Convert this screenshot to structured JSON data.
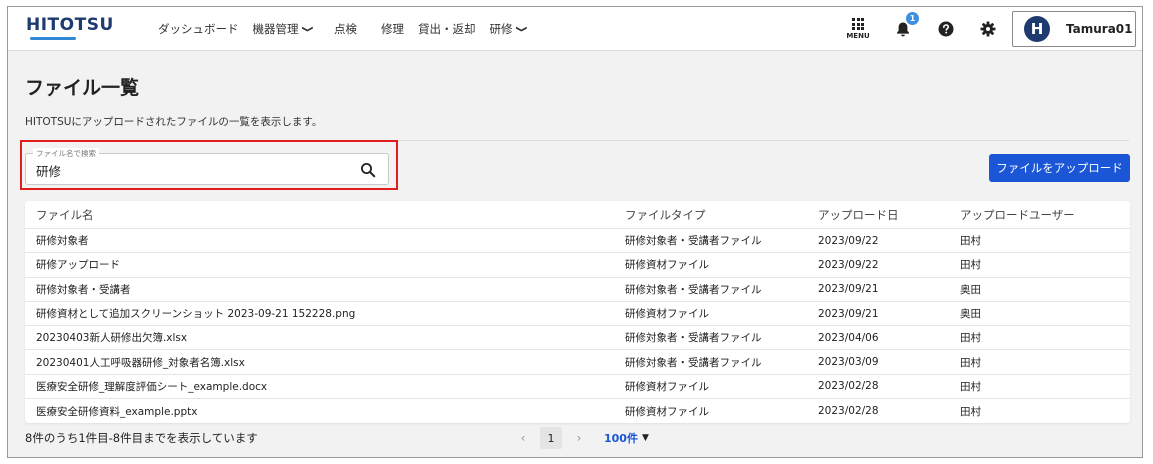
{
  "header": {
    "logo": "HITOTSU",
    "nav": [
      {
        "label": "ダッシュボード",
        "has_dropdown": false
      },
      {
        "label": "機器管理",
        "has_dropdown": true
      },
      {
        "label": "点検",
        "has_dropdown": false
      },
      {
        "label": "修理",
        "has_dropdown": false
      },
      {
        "label": "貸出・返却",
        "has_dropdown": false
      },
      {
        "label": "研修",
        "has_dropdown": true
      }
    ],
    "menu_label": "MENU",
    "notification_count": "1",
    "user": {
      "initial": "H",
      "name": "Tamura01"
    }
  },
  "page": {
    "title": "ファイル一覧",
    "description": "HITOTSUにアップロードされたファイルの一覧を表示します。"
  },
  "search": {
    "legend": "ファイル名で検索",
    "value": "研修"
  },
  "upload_button": "ファイルをアップロード",
  "table": {
    "columns": [
      "ファイル名",
      "ファイルタイプ",
      "アップロード日",
      "アップロードユーザー"
    ],
    "rows": [
      [
        "研修対象者",
        "研修対象者・受講者ファイル",
        "2023/09/22",
        "田村"
      ],
      [
        "研修アップロード",
        "研修資材ファイル",
        "2023/09/22",
        "田村"
      ],
      [
        "研修対象者・受講者",
        "研修対象者・受講者ファイル",
        "2023/09/21",
        "奥田"
      ],
      [
        "研修資材として追加スクリーンショット 2023-09-21 152228.png",
        "研修資材ファイル",
        "2023/09/21",
        "奥田"
      ],
      [
        "20230403新人研修出欠簿.xlsx",
        "研修対象者・受講者ファイル",
        "2023/04/06",
        "田村"
      ],
      [
        "20230401人工呼吸器研修_対象者名簿.xlsx",
        "研修対象者・受講者ファイル",
        "2023/03/09",
        "田村"
      ],
      [
        "医療安全研修_理解度評価シート_example.docx",
        "研修資材ファイル",
        "2023/02/28",
        "田村"
      ],
      [
        "医療安全研修資料_example.pptx",
        "研修資材ファイル",
        "2023/02/28",
        "田村"
      ]
    ]
  },
  "footer": {
    "count_text": "8件のうち1件目-8件目までを表示しています",
    "current_page": "1",
    "page_size": "100件"
  },
  "colors": {
    "primary": "#1a56d6",
    "logo": "#1d3b6f",
    "highlight": "#e01e1e",
    "badge": "#3d8fe3"
  }
}
